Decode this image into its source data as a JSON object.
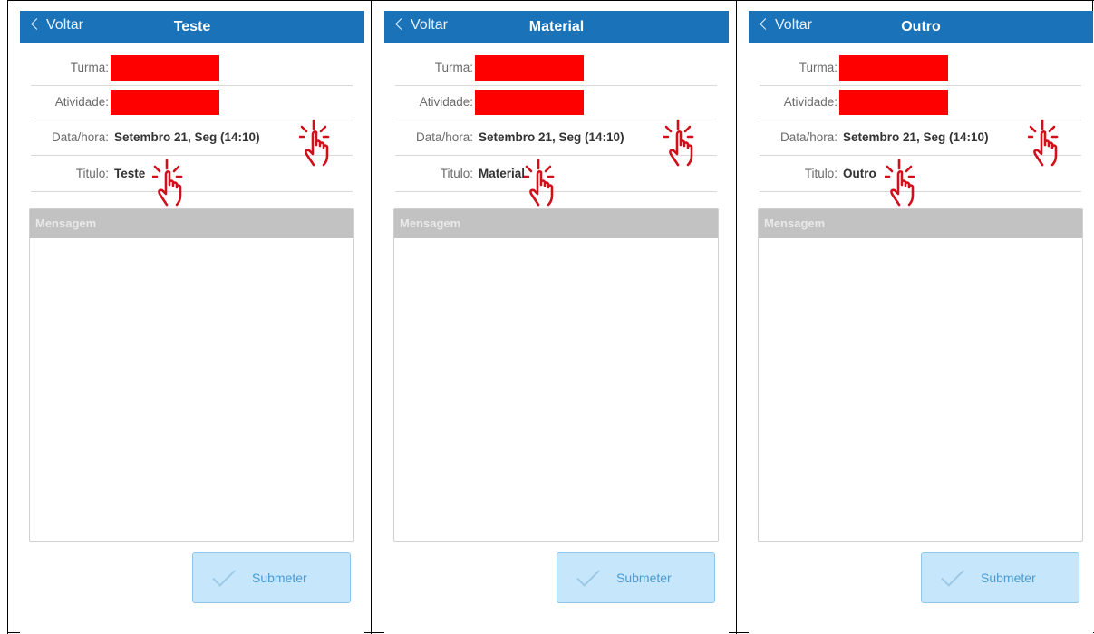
{
  "screens": [
    {
      "back_label": "Voltar",
      "title": "Teste",
      "fields": {
        "turma_label": "Turma:",
        "atividade_label": "Atividade:",
        "datahora_label": "Data/hora:",
        "datahora_value": "Setembro 21, Seg (14:10)",
        "titulo_label": "Titulo:",
        "titulo_value": "Teste"
      },
      "mensagem_label": "Mensagem",
      "submit_label": "Submeter"
    },
    {
      "back_label": "Voltar",
      "title": "Material",
      "fields": {
        "turma_label": "Turma:",
        "atividade_label": "Atividade:",
        "datahora_label": "Data/hora:",
        "datahora_value": "Setembro 21, Seg (14:10)",
        "titulo_label": "Titulo:",
        "titulo_value": "Material"
      },
      "mensagem_label": "Mensagem",
      "submit_label": "Submeter"
    },
    {
      "back_label": "Voltar",
      "title": "Outro",
      "fields": {
        "turma_label": "Turma:",
        "atividade_label": "Atividade:",
        "datahora_label": "Data/hora:",
        "datahora_value": "Setembro 21, Seg (14:10)",
        "titulo_label": "Titulo:",
        "titulo_value": "Outro"
      },
      "mensagem_label": "Mensagem",
      "submit_label": "Submeter"
    }
  ],
  "colors": {
    "topbar": "#1a73b8",
    "redaction": "#ff0000",
    "hand_icon": "#d0101a",
    "submit_bg": "#c6e6fb"
  },
  "icons": [
    "chevron-left-icon",
    "tap-hand-icon",
    "checkmark-icon"
  ]
}
